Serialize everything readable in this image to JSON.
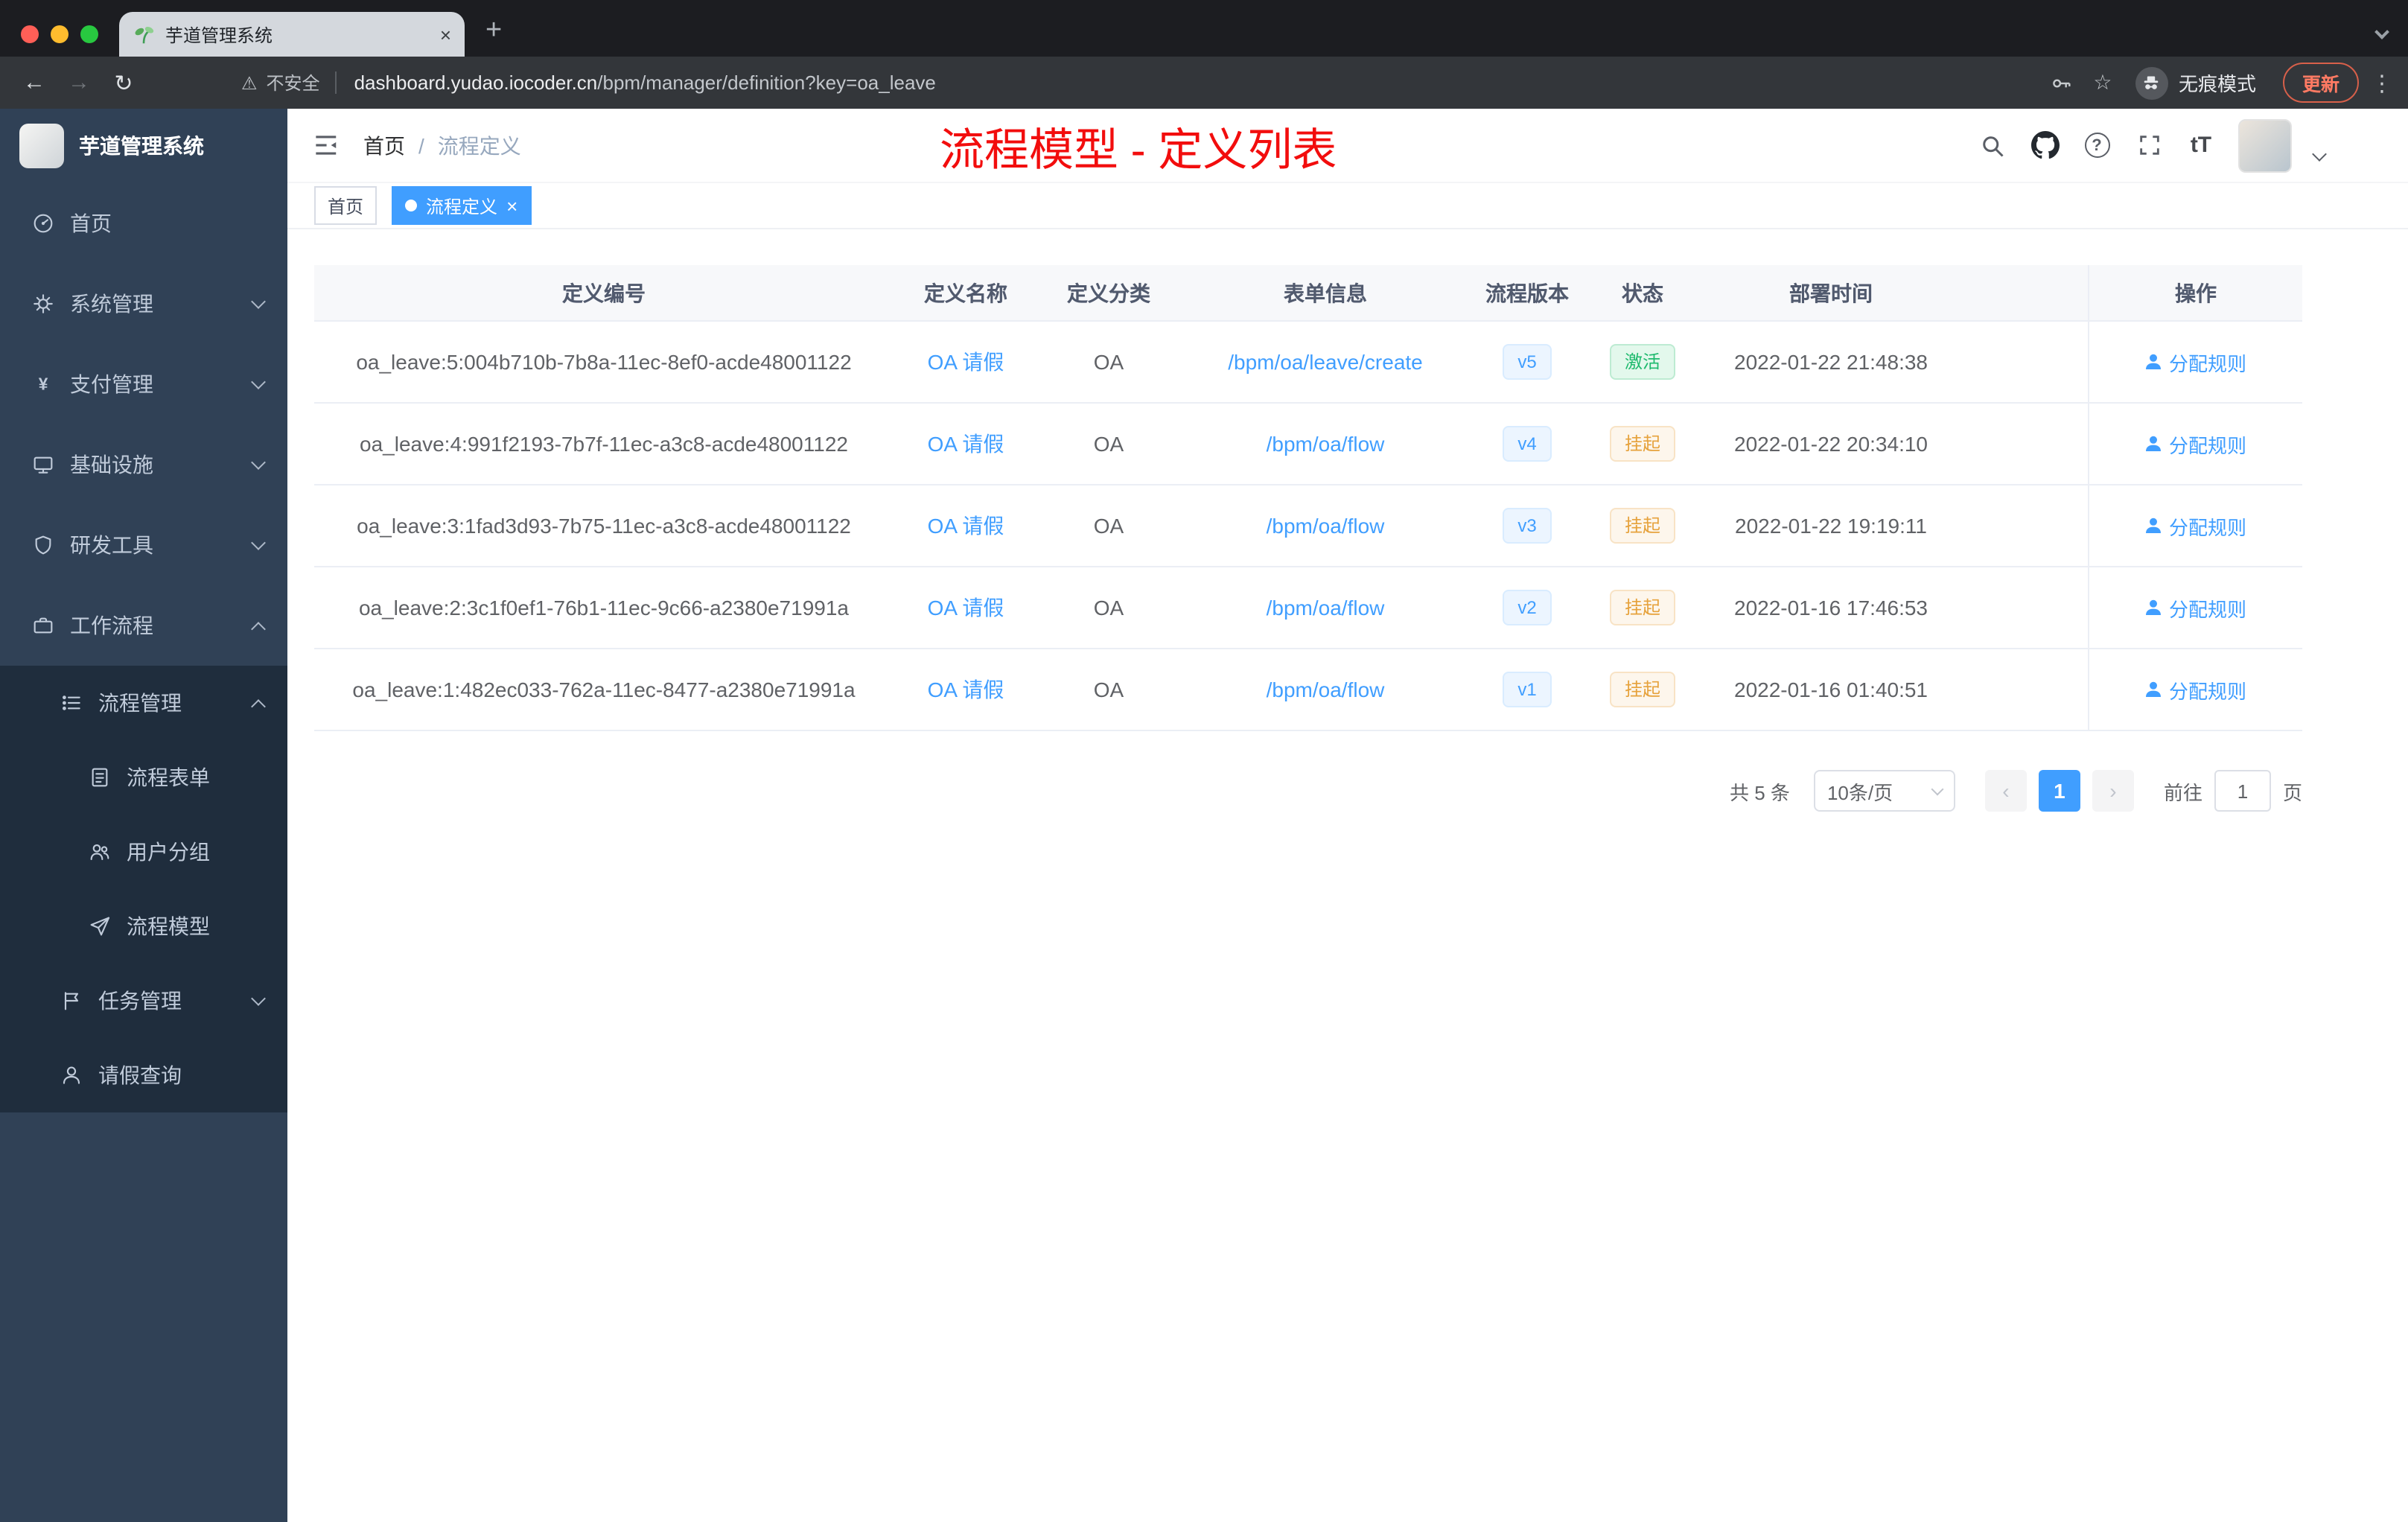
{
  "colors": {
    "accent": "#409eff",
    "annotation_red": "#f20d0d",
    "success": "#1fba6e",
    "warning": "#e6a23c"
  },
  "glyphs": {
    "close": "×",
    "plus": "+",
    "kebab": "⋮",
    "star": "☆",
    "warning": "⚠",
    "back": "←",
    "forward": "→",
    "refresh": "↻",
    "question": "?",
    "text_size": "tT"
  },
  "browser": {
    "tab_title": "芋道管理系统",
    "security_label": "不安全",
    "url_domain": "dashboard.yudao.iocoder.cn",
    "url_path": "/bpm/manager/definition?key=oa_leave",
    "incognito_label": "无痕模式",
    "update_label": "更新"
  },
  "sidebar": {
    "app_title": "芋道管理系统",
    "items": [
      {
        "key": "home",
        "label": "首页",
        "icon": "dashboard-icon",
        "level": 1
      },
      {
        "key": "system",
        "label": "系统管理",
        "icon": "gear-icon",
        "level": 1,
        "arrow": "down"
      },
      {
        "key": "payment",
        "label": "支付管理",
        "icon": "yen-icon",
        "level": 1,
        "arrow": "down"
      },
      {
        "key": "infra",
        "label": "基础设施",
        "icon": "monitor-icon",
        "level": 1,
        "arrow": "down"
      },
      {
        "key": "devtools",
        "label": "研发工具",
        "icon": "shield-icon",
        "level": 1,
        "arrow": "down"
      },
      {
        "key": "workflow",
        "label": "工作流程",
        "icon": "briefcase-icon",
        "level": 1,
        "arrow": "up"
      },
      {
        "key": "process-manage",
        "label": "流程管理",
        "icon": "list-icon",
        "level": 2,
        "arrow": "up"
      },
      {
        "key": "process-form",
        "label": "流程表单",
        "icon": "form-icon",
        "level": 3
      },
      {
        "key": "user-group",
        "label": "用户分组",
        "icon": "users-icon",
        "level": 3
      },
      {
        "key": "process-model",
        "label": "流程模型",
        "icon": "send-icon",
        "level": 3
      },
      {
        "key": "task-manage",
        "label": "任务管理",
        "icon": "flag-icon",
        "level": 2,
        "arrow": "down"
      },
      {
        "key": "leave-query",
        "label": "请假查询",
        "icon": "user-icon",
        "level": 2
      }
    ]
  },
  "header": {
    "breadcrumb_home": "首页",
    "breadcrumb_sep": "/",
    "breadcrumb_current": "流程定义",
    "annotation": "流程模型 - 定义列表"
  },
  "tags": [
    {
      "label": "首页",
      "active": false
    },
    {
      "label": "流程定义",
      "active": true
    }
  ],
  "table": {
    "columns": [
      "定义编号",
      "定义名称",
      "定义分类",
      "表单信息",
      "流程版本",
      "状态",
      "部署时间",
      "操作"
    ],
    "rows": [
      {
        "id": "oa_leave:5:004b710b-7b8a-11ec-8ef0-acde48001122",
        "name": "OA 请假",
        "category": "OA",
        "form": "/bpm/oa/leave/create",
        "version": "v5",
        "status": "激活",
        "status_type": "success",
        "deploy_time": "2022-01-22 21:48:38",
        "action": "分配规则"
      },
      {
        "id": "oa_leave:4:991f2193-7b7f-11ec-a3c8-acde48001122",
        "name": "OA 请假",
        "category": "OA",
        "form": "/bpm/oa/flow",
        "version": "v4",
        "status": "挂起",
        "status_type": "warning",
        "deploy_time": "2022-01-22 20:34:10",
        "action": "分配规则"
      },
      {
        "id": "oa_leave:3:1fad3d93-7b75-11ec-a3c8-acde48001122",
        "name": "OA 请假",
        "category": "OA",
        "form": "/bpm/oa/flow",
        "version": "v3",
        "status": "挂起",
        "status_type": "warning",
        "deploy_time": "2022-01-22 19:19:11",
        "action": "分配规则"
      },
      {
        "id": "oa_leave:2:3c1f0ef1-76b1-11ec-9c66-a2380e71991a",
        "name": "OA 请假",
        "category": "OA",
        "form": "/bpm/oa/flow",
        "version": "v2",
        "status": "挂起",
        "status_type": "warning",
        "deploy_time": "2022-01-16 17:46:53",
        "action": "分配规则"
      },
      {
        "id": "oa_leave:1:482ec033-762a-11ec-8477-a2380e71991a",
        "name": "OA 请假",
        "category": "OA",
        "form": "/bpm/oa/flow",
        "version": "v1",
        "status": "挂起",
        "status_type": "warning",
        "deploy_time": "2022-01-16 01:40:51",
        "action": "分配规则"
      }
    ]
  },
  "pagination": {
    "total": "共 5 条",
    "page_size": "10条/页",
    "prev": "‹",
    "current": "1",
    "next": "›",
    "goto_label": "前往",
    "goto_value": "1",
    "unit": "页"
  }
}
